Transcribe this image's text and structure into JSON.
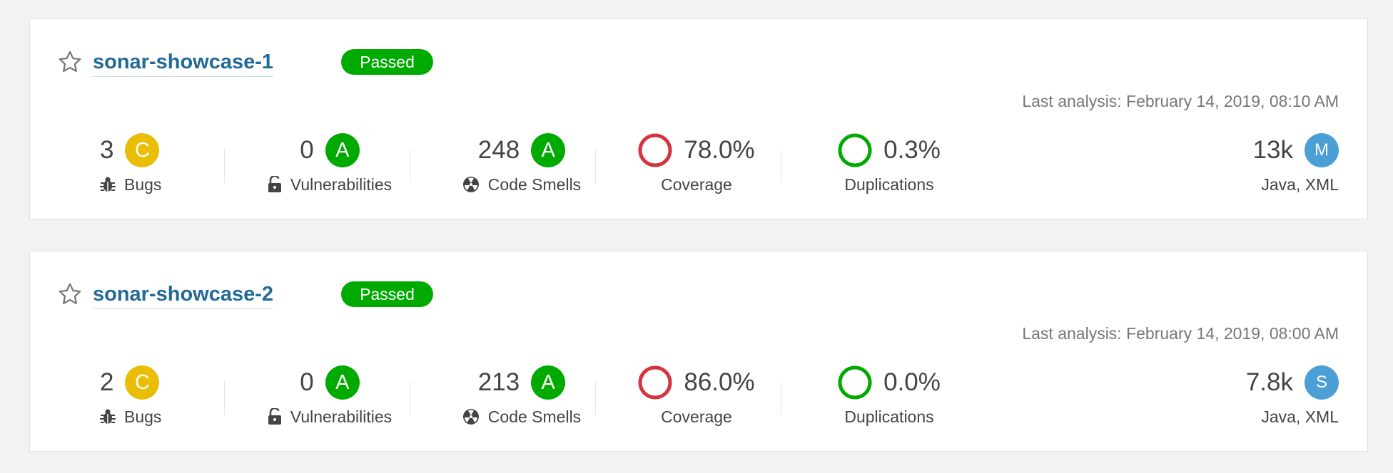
{
  "colors": {
    "link": "#236a97",
    "passed": "#00aa00",
    "rating_a": "#00aa00",
    "rating_c": "#eabe06",
    "coverage_ring": "#d4333f",
    "duplication_ring": "#00aa00",
    "size_badge": "#4b9fd5"
  },
  "projects": [
    {
      "name": "sonar-showcase-1",
      "quality_gate": "Passed",
      "last_analysis": "Last analysis: February 14, 2019, 08:10 AM",
      "bugs": {
        "value": "3",
        "rating": "C",
        "label": "Bugs",
        "icon": "bug-icon"
      },
      "vulnerabilities": {
        "value": "0",
        "rating": "A",
        "label": "Vulnerabilities",
        "icon": "lock-icon"
      },
      "code_smells": {
        "value": "248",
        "rating": "A",
        "label": "Code Smells",
        "icon": "radiation-icon"
      },
      "coverage": {
        "value": "78.0%",
        "label": "Coverage"
      },
      "duplications": {
        "value": "0.3%",
        "label": "Duplications"
      },
      "size": {
        "value": "13k",
        "rating": "M",
        "label": "Java, XML"
      }
    },
    {
      "name": "sonar-showcase-2",
      "quality_gate": "Passed",
      "last_analysis": "Last analysis: February 14, 2019, 08:00 AM",
      "bugs": {
        "value": "2",
        "rating": "C",
        "label": "Bugs",
        "icon": "bug-icon"
      },
      "vulnerabilities": {
        "value": "0",
        "rating": "A",
        "label": "Vulnerabilities",
        "icon": "lock-icon"
      },
      "code_smells": {
        "value": "213",
        "rating": "A",
        "label": "Code Smells",
        "icon": "radiation-icon"
      },
      "coverage": {
        "value": "86.0%",
        "label": "Coverage"
      },
      "duplications": {
        "value": "0.0%",
        "label": "Duplications"
      },
      "size": {
        "value": "7.8k",
        "rating": "S",
        "label": "Java, XML"
      }
    }
  ]
}
